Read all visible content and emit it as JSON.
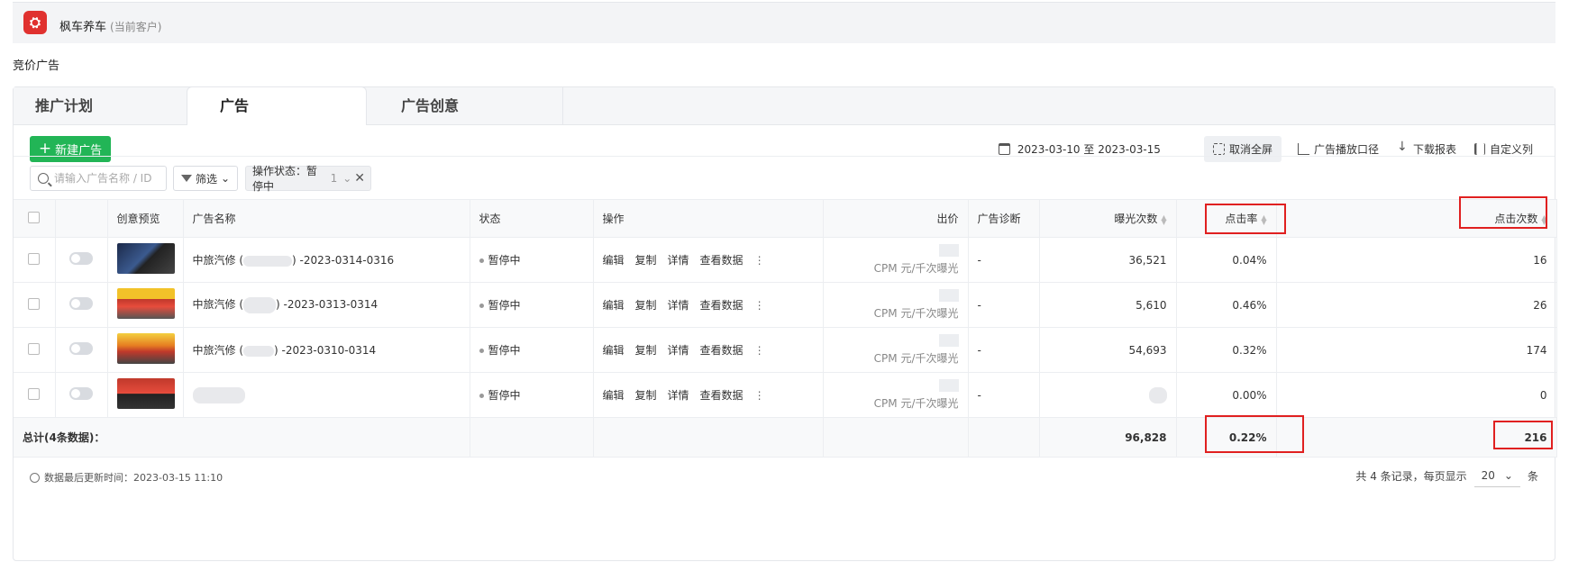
{
  "header": {
    "logo_text": "⛭",
    "client_name": "枫车养车",
    "client_tag": "(当前客户)"
  },
  "page_title": "竞价广告",
  "tabs": [
    "推广计划",
    "广告",
    "广告创意"
  ],
  "toolbar": {
    "new_button": "新建广告",
    "date_range": "2023-03-10 至 2023-03-15",
    "exit_fullscreen": "取消全屏",
    "delivery_scope": "广告播放口径",
    "download": "下载报表",
    "custom_columns": "自定义列"
  },
  "filters": {
    "search_placeholder": "请输入广告名称 / ID",
    "filter_label": "筛选",
    "chip_label": "操作状态：暂停中",
    "chip_count": "1"
  },
  "table": {
    "columns": [
      "创意预览",
      "广告名称",
      "状态",
      "操作",
      "出价",
      "广告诊断",
      "曝光次数",
      "点击率",
      "点击次数"
    ],
    "actions": [
      "编辑",
      "复制",
      "详情",
      "查看数据"
    ],
    "bid_unit": "CPM 元/千次曝光",
    "rows": [
      {
        "name_prefix": "中旅汽修 (",
        "name_suffix": ") -2023-0314-0316",
        "status": "暂停中",
        "diagnosis": "-",
        "impressions": "36,521",
        "ctr": "0.04%",
        "clicks": "16"
      },
      {
        "name_prefix": "中旅汽修 (",
        "name_suffix": ") -2023-0313-0314",
        "status": "暂停中",
        "diagnosis": "-",
        "impressions": "5,610",
        "ctr": "0.46%",
        "clicks": "26"
      },
      {
        "name_prefix": "中旅汽修 (",
        "name_suffix": ") -2023-0310-0314",
        "status": "暂停中",
        "diagnosis": "-",
        "impressions": "54,693",
        "ctr": "0.32%",
        "clicks": "174"
      },
      {
        "name_prefix": "",
        "name_suffix": "",
        "status": "暂停中",
        "diagnosis": "-",
        "impressions": "",
        "ctr": "0.00%",
        "clicks": "0"
      }
    ],
    "total": {
      "label": "总计(4条数据)：",
      "impressions": "96,828",
      "ctr": "0.22%",
      "clicks": "216"
    }
  },
  "footer": {
    "updated": "数据最后更新时间：2023-03-15 11:10",
    "records": "共 4 条记录，每页显示",
    "page_size": "20",
    "unit": "条"
  },
  "colors": {
    "primary_green": "#22b556",
    "highlight_red": "#e02020"
  }
}
